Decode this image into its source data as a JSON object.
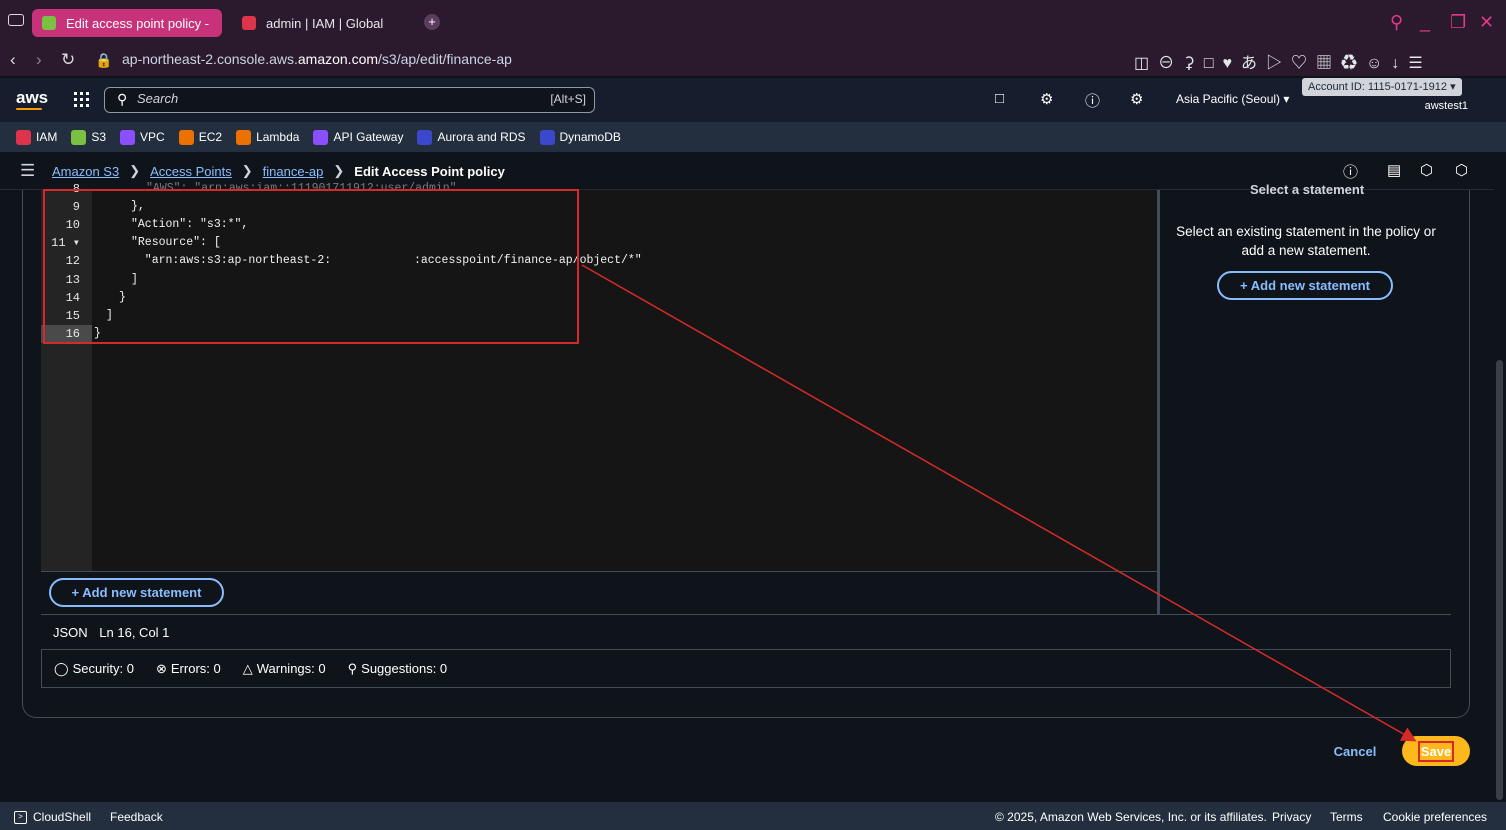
{
  "browser": {
    "tabs": [
      {
        "label": "Edit access point policy -",
        "active": true
      },
      {
        "label": "admin | IAM | Global",
        "active": false
      }
    ],
    "new_tab": "+",
    "url_prefix": "ap-northeast-2.console.aws.",
    "url_domain": "amazon.com",
    "url_path": "/s3/ap/edit/finance-ap"
  },
  "aws_nav": {
    "logo": "aws",
    "search_placeholder": "Search",
    "search_shortcut": "[Alt+S]",
    "region": "Asia Pacific (Seoul) ▾",
    "account_id": "Account ID: 1115-0171-1912 ▾",
    "username": "awstest1"
  },
  "favorites": [
    "IAM",
    "S3",
    "VPC",
    "EC2",
    "Lambda",
    "API Gateway",
    "Aurora and RDS",
    "DynamoDB"
  ],
  "favorite_colors": [
    "#dd344c",
    "#7ac143",
    "#8c4fff",
    "#ed7100",
    "#ed7100",
    "#8c4fff",
    "#3b48cc",
    "#3b48cc"
  ],
  "breadcrumb": {
    "items": [
      "Amazon S3",
      "Access Points",
      "finance-ap"
    ],
    "current": "Edit Access Point policy"
  },
  "editor": {
    "lines": [
      {
        "num": "8",
        "code": "\"AWS\": \"arn:aws:iam::111901711912:user/admin\""
      },
      {
        "num": "9",
        "code": "},"
      },
      {
        "num": "10",
        "code": "\"Action\": \"s3:*\","
      },
      {
        "num": "11 ▾",
        "code": "\"Resource\": ["
      },
      {
        "num": "12",
        "code": "  \"arn:aws:s3:ap-northeast-2:            :accesspoint/finance-ap/object/*\""
      },
      {
        "num": "13",
        "code": "]"
      },
      {
        "num": "14",
        "code": "}"
      },
      {
        "num": "15",
        "code": "]"
      },
      {
        "num": "16",
        "code": "}"
      }
    ],
    "add_statement_label": "+ Add new statement",
    "status_mode": "JSON",
    "status_position": "Ln 16, Col 1"
  },
  "right_pane": {
    "title": "Select a statement",
    "text": "Select an existing statement in the policy or add a new statement.",
    "add_label": "+ Add new statement"
  },
  "lint": {
    "security": "Security: 0",
    "errors": "Errors: 0",
    "warnings": "Warnings: 0",
    "suggestions": "Suggestions: 0"
  },
  "actions": {
    "cancel": "Cancel",
    "save": "Save"
  },
  "footer": {
    "cloudshell": "CloudShell",
    "feedback": "Feedback",
    "copyright": "© 2025, Amazon Web Services, Inc. or its affiliates.",
    "privacy": "Privacy",
    "terms": "Terms",
    "cookies": "Cookie preferences"
  },
  "colors": {
    "link": "#89bdff",
    "save_button": "#ffb81c",
    "annotation": "#d62a2a",
    "tab_active": "#c8327a"
  }
}
